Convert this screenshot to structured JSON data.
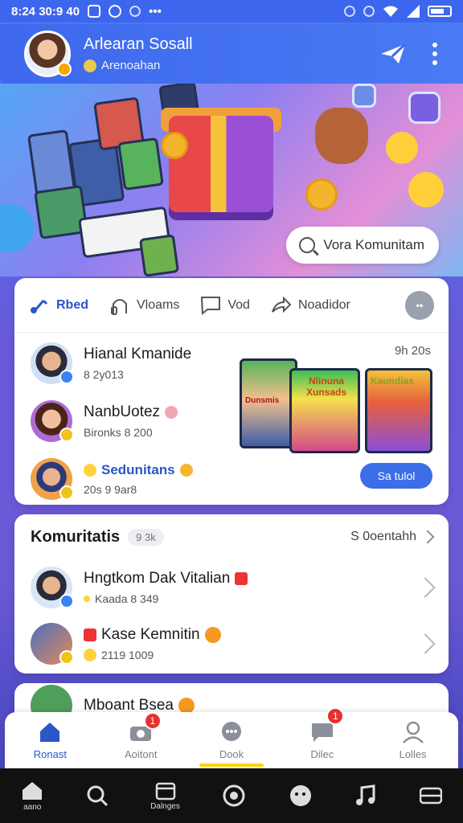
{
  "status_bar": {
    "time": "8:24 30:9 40"
  },
  "header": {
    "title": "Arlearan Sosall",
    "subtitle": "Arenoahan"
  },
  "banner": {
    "community_chip": "Vora Komunitam"
  },
  "feed_card": {
    "tabs": [
      {
        "label": "Rbed",
        "icon": "music-note-icon",
        "active": true
      },
      {
        "label": "Vloams",
        "icon": "headphones-icon",
        "active": false
      },
      {
        "label": "Vod",
        "icon": "chat-bubble-icon",
        "active": false
      },
      {
        "label": "Noadidor",
        "icon": "share-arrow-icon",
        "active": false
      }
    ],
    "time": "9h 20s",
    "rows": [
      {
        "name": "Hianal Kmanide",
        "meta": "8 2y013",
        "badge_color": "#3b82f6"
      },
      {
        "name": "NanbUotez",
        "meta": "Bironks 8 200",
        "badge_color": "#f0c419"
      },
      {
        "name": "Sedunitans",
        "meta": "20s 9 9ar8",
        "badge_color": "#f0c419"
      }
    ],
    "thumbnails": [
      "Dunsmis",
      "Nlinuna Xunsads",
      "Kaundias"
    ],
    "more_button": "Sa tulol"
  },
  "community_card": {
    "title": "Komuritatis",
    "count": "9 3k",
    "link": "S 0oentahh",
    "rows": [
      {
        "name": "Hngtkom Dak Vitalian",
        "meta": "Kaada 8 349"
      },
      {
        "name": "Kase Kemnitin",
        "meta": "2119 1009"
      }
    ]
  },
  "peek_card": {
    "name": "Mboant Bsea"
  },
  "app_nav": [
    {
      "label": "Ronast",
      "icon": "home-icon",
      "active": true,
      "badge": ""
    },
    {
      "label": "Aoitont",
      "icon": "camera-icon",
      "active": false,
      "badge": "1"
    },
    {
      "label": "Dook",
      "icon": "chat-icon",
      "active": false,
      "badge": ""
    },
    {
      "label": "Dilec",
      "icon": "message-icon",
      "active": false,
      "badge": "1"
    },
    {
      "label": "Lolles",
      "icon": "profile-icon",
      "active": false,
      "badge": ""
    }
  ],
  "system_nav": [
    {
      "label": "aano",
      "icon": "home-icon"
    },
    {
      "label": "",
      "icon": "search-icon"
    },
    {
      "label": "Dalnges",
      "icon": "calendar-icon"
    },
    {
      "label": "",
      "icon": "record-icon"
    },
    {
      "label": "",
      "icon": "sticker-icon"
    },
    {
      "label": "",
      "icon": "music-icon"
    },
    {
      "label": "",
      "icon": "menu-icon"
    }
  ],
  "colors": {
    "primary": "#3d66ee",
    "accent": "#2a56c8",
    "notification": "#e7312f",
    "active_indicator": "#ffd400"
  }
}
